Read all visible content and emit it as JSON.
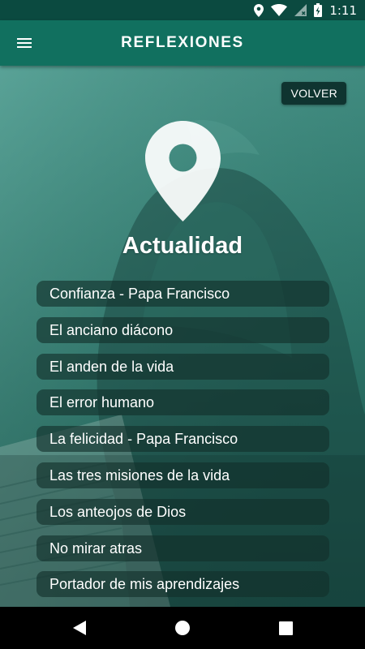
{
  "status_bar": {
    "time": "1:11",
    "icons": [
      "location-icon",
      "wifi-icon",
      "no-sim-icon",
      "battery-charging-icon"
    ]
  },
  "app_bar": {
    "title": "REFLEXIONES",
    "menu_icon": "hamburger-menu-icon"
  },
  "main": {
    "back_button_label": "VOLVER",
    "header_icon": "location-pin-icon",
    "section_title": "Actualidad",
    "items": [
      {
        "label": "Confianza - Papa Francisco"
      },
      {
        "label": "El anciano diácono"
      },
      {
        "label": "El anden de la vida"
      },
      {
        "label": "El error humano"
      },
      {
        "label": "La felicidad - Papa Francisco"
      },
      {
        "label": "Las tres misiones de la vida"
      },
      {
        "label": "Los anteojos de Dios"
      },
      {
        "label": "No mirar atras"
      },
      {
        "label": "Portador de mis aprendizajes"
      }
    ]
  },
  "nav_bar": {
    "buttons": [
      "back-triangle-icon",
      "home-circle-icon",
      "recents-square-icon"
    ]
  },
  "colors": {
    "status_bar": "#0b4a40",
    "app_bar": "#11705f",
    "content_tint": "#2f7a6e",
    "list_item_bg": "#122e2a",
    "back_button_bg": "#0f3430",
    "text": "#ffffff"
  }
}
